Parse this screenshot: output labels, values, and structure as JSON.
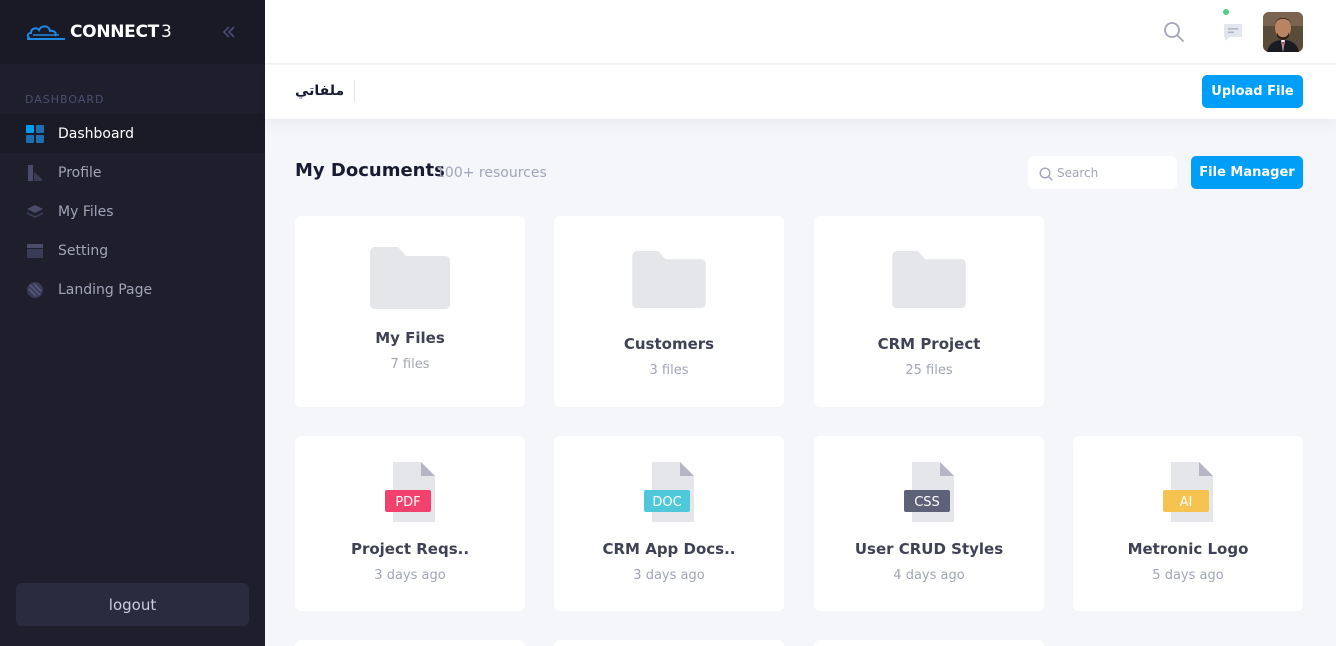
{
  "brand": {
    "name": "CONNECT",
    "version": "3"
  },
  "sidebar": {
    "section_label": "DASHBOARD",
    "items": [
      {
        "label": "Dashboard",
        "icon": "grid-icon",
        "active": true
      },
      {
        "label": "Profile",
        "icon": "profile-icon",
        "active": false
      },
      {
        "label": "My Files",
        "icon": "layers-icon",
        "active": false
      },
      {
        "label": "Setting",
        "icon": "window-icon",
        "active": false
      },
      {
        "label": "Landing Page",
        "icon": "globe-icon",
        "active": false
      }
    ],
    "logout_label": "logout"
  },
  "header": {
    "search_icon": "search-icon",
    "chat_icon": "chat-icon",
    "notification_dot_color": "#50cd89"
  },
  "toolbar": {
    "page_title": "ملفاتي",
    "upload_label": "Upload File"
  },
  "documents": {
    "title": "My Documents",
    "subtitle": "100+ resources",
    "search_placeholder": "Search",
    "file_manager_label": "File Manager",
    "folders": [
      {
        "name": "My Files",
        "count": "7 files"
      },
      {
        "name": "Customers",
        "count": "3 files"
      },
      {
        "name": "CRM Project",
        "count": "25 files"
      }
    ],
    "files": [
      {
        "name": "Project Reqs..",
        "type": "PDF",
        "color": "#f1416c",
        "time": "3 days ago"
      },
      {
        "name": "CRM App Docs..",
        "type": "DOC",
        "color": "#4fc9da",
        "time": "3 days ago"
      },
      {
        "name": "User CRUD Styles",
        "type": "CSS",
        "color": "#5e6278",
        "time": "4 days ago"
      },
      {
        "name": "Metronic Logo",
        "type": "AI",
        "color": "#f6c350",
        "time": "5 days ago"
      }
    ]
  },
  "colors": {
    "primary": "#009ef7",
    "sidebar_bg": "#1e1e2d",
    "page_bg": "#f4f6fa"
  }
}
